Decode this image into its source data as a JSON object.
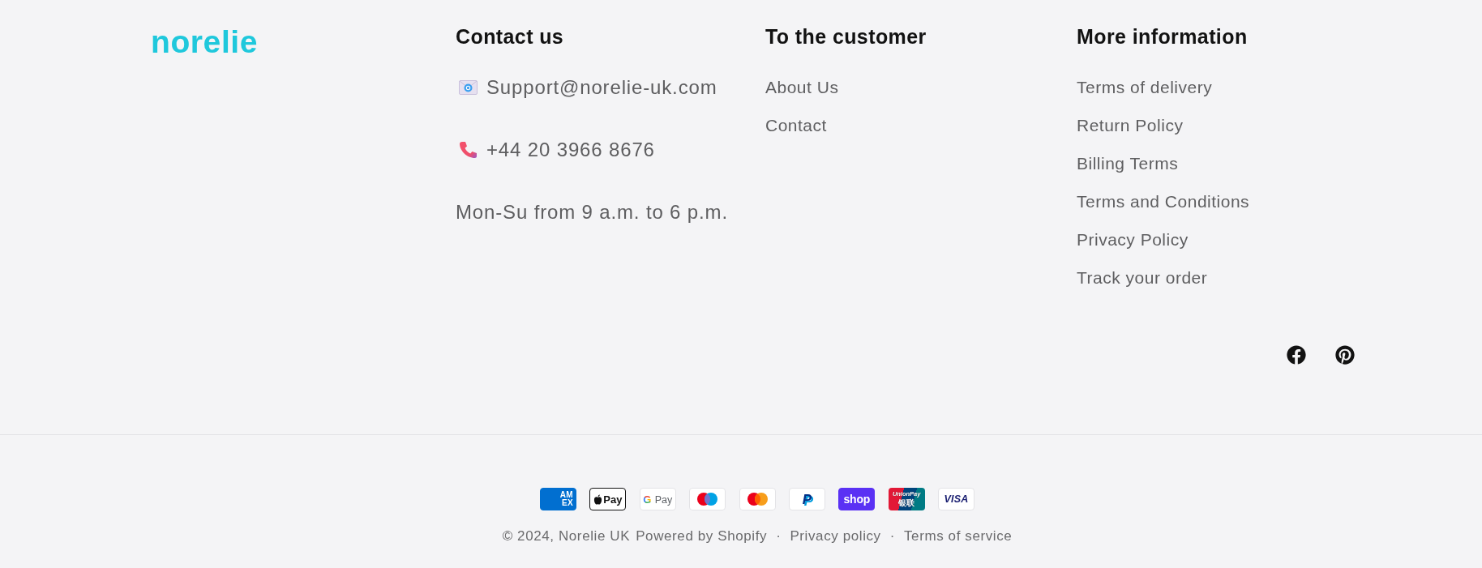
{
  "logo": {
    "text": "norelie"
  },
  "columns": [
    {
      "kind": "contact",
      "heading": "Contact us",
      "items": [
        {
          "kind": "email",
          "text": "Support@norelie-uk.com"
        },
        {
          "kind": "phone",
          "text": "+44 20 3966 8676"
        },
        {
          "kind": "hours",
          "text": "Mon-Su from 9 a.m. to 6 p.m."
        }
      ]
    },
    {
      "kind": "links",
      "heading": "To the customer",
      "links": [
        "About Us",
        "Contact"
      ]
    },
    {
      "kind": "links",
      "heading": "More information",
      "links": [
        "Terms of delivery",
        "Return Policy",
        "Billing Terms",
        "Terms and Conditions",
        "Privacy Policy",
        "Track your order"
      ]
    }
  ],
  "social": [
    {
      "kind": "facebook"
    },
    {
      "kind": "pinterest"
    }
  ],
  "payment_icons": [
    {
      "kind": "amex",
      "lines": [
        "AM",
        "EX"
      ]
    },
    {
      "kind": "apple_pay",
      "label": "Pay"
    },
    {
      "kind": "google_pay",
      "mark": "G",
      "label": "Pay"
    },
    {
      "kind": "maestro"
    },
    {
      "kind": "mastercard"
    },
    {
      "kind": "paypal",
      "mark": "P"
    },
    {
      "kind": "shop_pay",
      "label": "shop"
    },
    {
      "kind": "unionpay",
      "lines": [
        "UnionPay",
        "银联"
      ]
    },
    {
      "kind": "visa",
      "label": "VISA"
    }
  ],
  "bottom_bar": {
    "copyright": "© 2024, Norelie UK",
    "powered_by": "Powered by Shopify",
    "policies": [
      {
        "separator": "·",
        "label": "Privacy policy"
      },
      {
        "separator": "·",
        "label": "Terms of service"
      }
    ]
  }
}
